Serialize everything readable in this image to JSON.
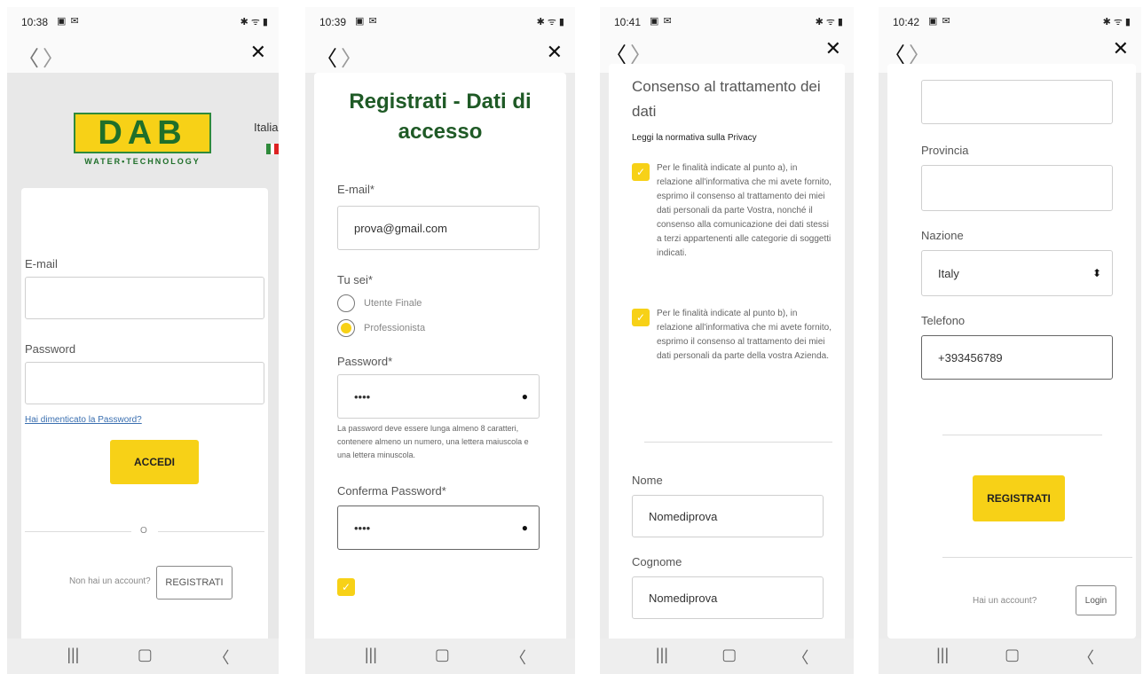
{
  "status_times": [
    "10:38",
    "10:39",
    "10:41",
    "10:42"
  ],
  "noti_icons": "▣ ✉",
  "sys_icons": "✱ ᯤ ▮",
  "nav": {
    "back": "〈",
    "forward": "〉",
    "close": "✕"
  },
  "bottom_nav": [
    "|||",
    "▢",
    "〈"
  ],
  "screen1": {
    "logo_text": "DAB",
    "logo_sub": "WATER•TECHNOLOGY",
    "language": "Italia",
    "email_label": "E-mail",
    "password_label": "Password",
    "forgot_link": "Hai dimenticato la Password?",
    "login_button": "ACCEDI",
    "divider": "O",
    "no_account": "Non hai un account?",
    "register_button": "REGISTRATI"
  },
  "screen2": {
    "title": "Registrati - Dati di accesso",
    "email_label": "E-mail*",
    "email_value": "prova@gmail.com",
    "tu_sei_label": "Tu sei*",
    "option_1": "Utente Finale",
    "option_2": "Professionista",
    "password_label": "Password*",
    "password_value": "••••",
    "password_hint": "La password deve essere lunga almeno 8 caratteri, contenere almeno un numero, una lettera maiuscola e una lettera minuscola.",
    "confirm_label": "Conferma Password*",
    "confirm_value": "••••"
  },
  "screen3": {
    "consent_title": "Consenso al trattamento dei dati",
    "privacy_link": "Leggi la normativa sulla Privacy",
    "consent_a": "Per le finalità indicate al punto a), in relazione all'informativa che mi avete fornito, esprimo il consenso al trattamento dei miei dati personali da parte Vostra, nonché il consenso alla comunicazione dei dati stessi a terzi appartenenti alle categorie di soggetti indicati.",
    "consent_b": "Per le finalità indicate al punto b), in relazione all'informativa che mi avete fornito, esprimo il consenso al trattamento dei miei dati personali da parte della vostra Azienda.",
    "nome_label": "Nome",
    "nome_value": "Nomediprova",
    "cognome_label": "Cognome",
    "cognome_value": "Nomediprova"
  },
  "screen4": {
    "provincia_label": "Provincia",
    "nazione_label": "Nazione",
    "nazione_value": "Italy",
    "telefono_label": "Telefono",
    "telefono_value": "+393456789",
    "register_button": "REGISTRATI",
    "have_account": "Hai un account?",
    "login_button": "Login"
  },
  "colors": {
    "accent": "#f7d117",
    "brand_green": "#1f6f2a"
  },
  "icons": {
    "eye": "eye-icon",
    "check": "checkmark-icon",
    "select": "select-arrows-icon"
  }
}
